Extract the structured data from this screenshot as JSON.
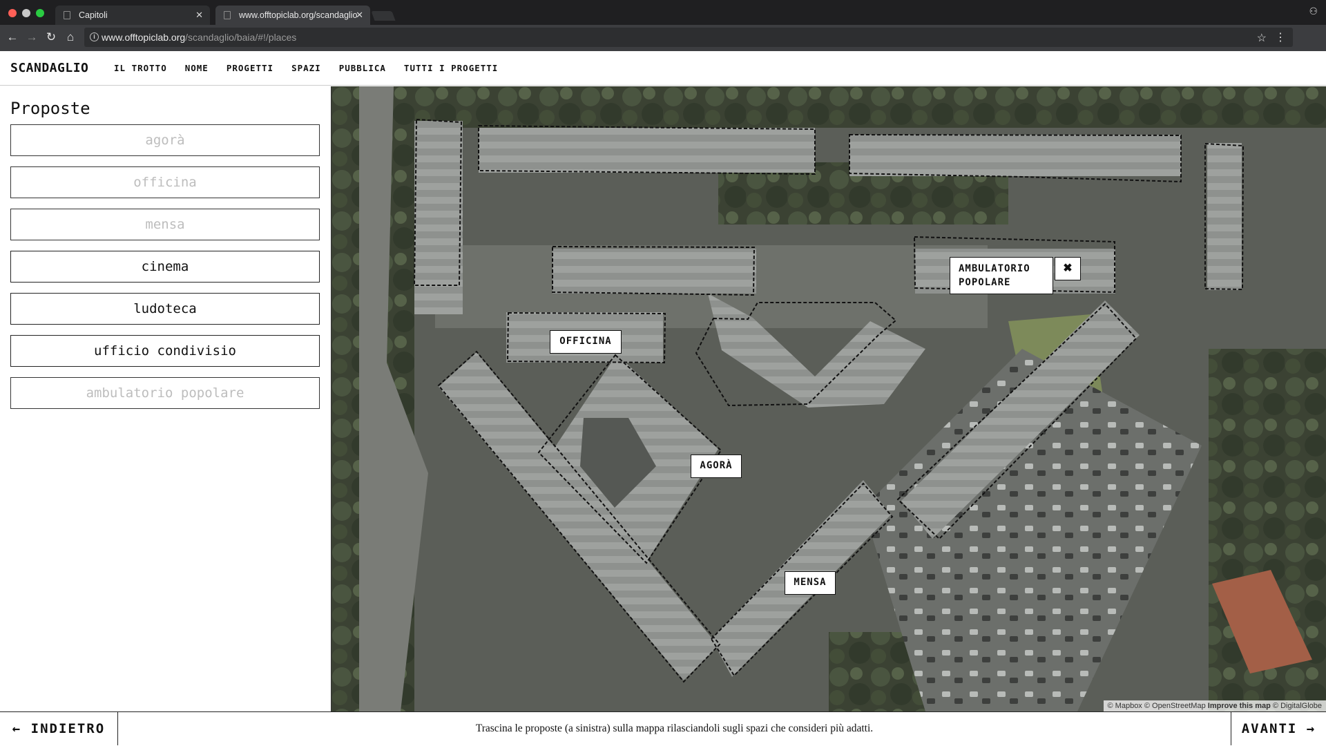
{
  "browser": {
    "tabs": [
      {
        "title": "Capitoli"
      },
      {
        "title": "www.offtopiclab.org/scandaglio"
      }
    ],
    "url_host": "www.offtopiclab.org",
    "url_path": "/scandaglio/baia/#!/places"
  },
  "header": {
    "logo": "SCANDAGLIO",
    "menu": [
      "IL TROTTO",
      "NOME",
      "PROGETTI",
      "SPAZI",
      "PUBBLICA",
      "TUTTI I PROGETTI"
    ]
  },
  "panel": {
    "title": "Proposte",
    "items": [
      {
        "label": "agorà",
        "used": true
      },
      {
        "label": "officina",
        "used": true
      },
      {
        "label": "mensa",
        "used": true
      },
      {
        "label": "cinema",
        "used": false
      },
      {
        "label": "ludoteca",
        "used": false
      },
      {
        "label": "ufficio condivisio",
        "used": false
      },
      {
        "label": "ambulatorio popolare",
        "used": true
      }
    ]
  },
  "map": {
    "labels": {
      "officina": "OFFICINA",
      "agora": "AGORÀ",
      "mensa": "MENSA",
      "ambulatorio_line1": "AMBULATORIO",
      "ambulatorio_line2": "POPOLARE"
    },
    "close_glyph": "✖",
    "attribution": {
      "mapbox": "© Mapbox",
      "osm": "© OpenStreetMap",
      "improve": "Improve this map",
      "digitalglobe": "© DigitalGlobe"
    }
  },
  "footer": {
    "back": "← INDIETRO",
    "instruction": "Trascina le proposte (a sinistra) sulla mappa rilasciandoli sugli spazi che consideri più adatti.",
    "next": "AVANTI →"
  },
  "colors": {
    "map_dark": "#3a3d38",
    "tree_green": "#3f4a35",
    "roof_gray": "#8c8f8c",
    "lawn": "#7d8a5a"
  }
}
